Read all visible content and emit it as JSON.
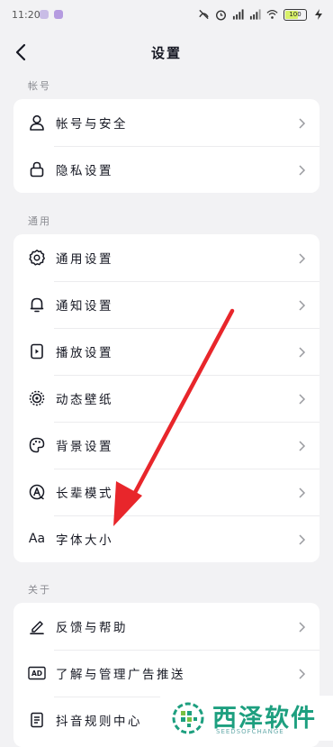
{
  "status_bar": {
    "time": "11:20",
    "battery": "100"
  },
  "header": {
    "title": "设置"
  },
  "sections": [
    {
      "label": "帐号",
      "items": [
        {
          "label": "帐号与安全"
        },
        {
          "label": "隐私设置"
        }
      ]
    },
    {
      "label": "通用",
      "items": [
        {
          "label": "通用设置"
        },
        {
          "label": "通知设置"
        },
        {
          "label": "播放设置"
        },
        {
          "label": "动态壁纸"
        },
        {
          "label": "背景设置"
        },
        {
          "label": "长辈模式"
        },
        {
          "label": "字体大小",
          "icon_text": "Aa"
        }
      ]
    },
    {
      "label": "关于",
      "items": [
        {
          "label": "反馈与帮助"
        },
        {
          "label": "了解与管理广告推送",
          "icon_text": "AD"
        },
        {
          "label": "抖音规则中心"
        }
      ]
    }
  ],
  "watermark": {
    "brand": "西泽软件",
    "sub": "SEEDSOFCHANGE"
  },
  "colors": {
    "accent_arrow": "#e8262b",
    "watermark": "#1d9f7f"
  }
}
